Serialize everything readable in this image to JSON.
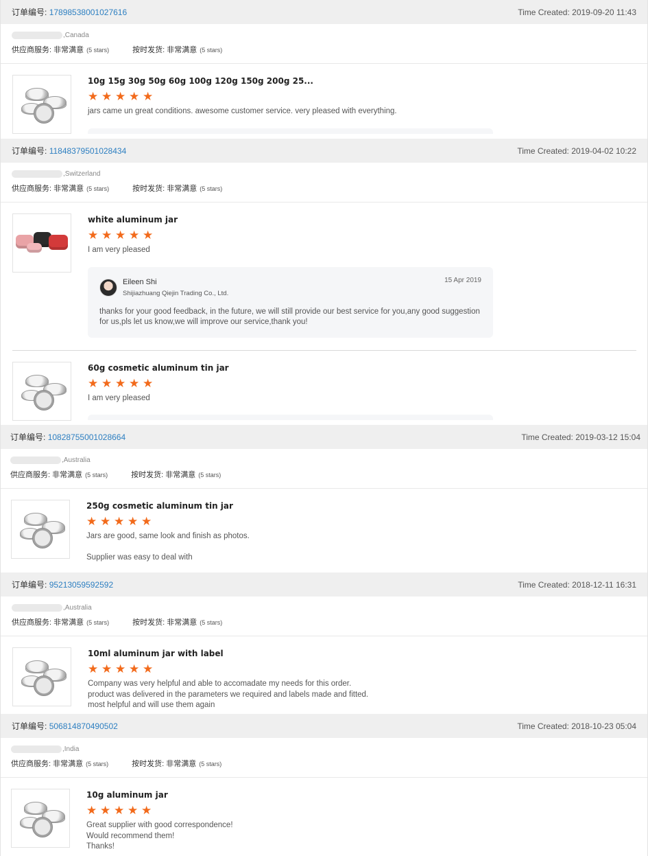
{
  "labels": {
    "order_no": "订单编号:",
    "supplier_service": "供应商服务:",
    "on_time": "按时发货:",
    "very_satisfied": "非常满意",
    "five_stars": "(5 stars)",
    "time_created": "Time Created:"
  },
  "orders": [
    {
      "order_number": "17898538001027616",
      "time": "2019-09-20 11:43",
      "country": ",Canada",
      "products": [
        {
          "title": "10g 15g 30g 50g 60g 100g 120g 150g 200g 25...",
          "rating": 5,
          "comment": "jars came un great conditions. awesome customer service. very pleased with everything.",
          "image": "silver-jars"
        }
      ]
    },
    {
      "order_number": "11848379501028434",
      "time": "2019-04-02 10:22",
      "country": ",Switzerland",
      "products": [
        {
          "title": "white aluminum jar",
          "rating": 5,
          "comment": "I am very pleased",
          "image": "colored-jars",
          "reply": {
            "name": "Eileen Shi",
            "company": "Shijiazhuang Qiejin Trading Co., Ltd.",
            "date": "15 Apr 2019",
            "text": "thanks for your good feedback, in the future, we will still provide our best service for you,any good suggestion for us,pls let us know,we will improve our service,thank you!"
          }
        },
        {
          "title": "60g cosmetic aluminum tin jar",
          "rating": 5,
          "comment": "I am very pleased",
          "image": "silver-jars"
        }
      ]
    },
    {
      "order_number": "10828755001028664",
      "time": "2019-03-12 15:04",
      "country": ",Australia",
      "products": [
        {
          "title": "250g cosmetic aluminum tin jar",
          "rating": 5,
          "comment": "Jars are good, same look and finish as photos.\n\nSupplier was easy to deal with",
          "image": "silver-jars"
        }
      ]
    },
    {
      "order_number": "95213059592592",
      "time": "2018-12-11 16:31",
      "country": ",Australia",
      "products": [
        {
          "title": "10ml aluminum jar with label",
          "rating": 5,
          "comment": "Company was very helpful and able to accomadate my needs for this order.\nproduct was delivered in the parameters we required and labels made and fitted.\nmost helpful and will use them again",
          "image": "silver-jars"
        }
      ]
    },
    {
      "order_number": "506814870490502",
      "time": "2018-10-23 05:04",
      "country": ",India",
      "products": [
        {
          "title": "10g aluminum jar",
          "rating": 5,
          "comment": "Great supplier with good correspondence!\nWould recommend them!\nThanks!",
          "image": "silver-jars"
        }
      ]
    }
  ],
  "colors": {
    "star": "#f26a1b",
    "link": "#2d7fc1",
    "header_bg": "#efefef"
  }
}
